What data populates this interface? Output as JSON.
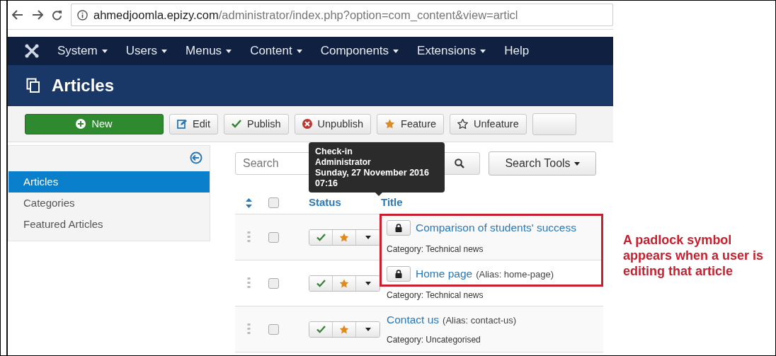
{
  "browser": {
    "host": "ahmedjoomla.epizy.com",
    "path": "/administrator/index.php?option=com_content&view=articl"
  },
  "menu": [
    {
      "label": "System",
      "caret": true
    },
    {
      "label": "Users",
      "caret": true
    },
    {
      "label": "Menus",
      "caret": true
    },
    {
      "label": "Content",
      "caret": true
    },
    {
      "label": "Components",
      "caret": true
    },
    {
      "label": "Extensions",
      "caret": true
    },
    {
      "label": "Help",
      "caret": false
    }
  ],
  "page_title": "Articles",
  "toolbar": [
    {
      "label": "New",
      "kind": "new"
    },
    {
      "label": "Edit",
      "kind": "edit"
    },
    {
      "label": "Publish",
      "kind": "publish"
    },
    {
      "label": "Unpublish",
      "kind": "unpublish"
    },
    {
      "label": "Feature",
      "kind": "feature"
    },
    {
      "label": "Unfeature",
      "kind": "unfeature"
    }
  ],
  "sidebar": [
    {
      "label": "Articles",
      "selected": true
    },
    {
      "label": "Categories",
      "selected": false
    },
    {
      "label": "Featured Articles",
      "selected": false
    }
  ],
  "search": {
    "placeholder": "Search"
  },
  "search_tools": "Search Tools",
  "columns": {
    "status": "Status",
    "title": "Title",
    "select_all_checked": false
  },
  "rows": [
    {
      "title": "Comparison of students' success",
      "alias": "",
      "category": "Category: Technical news",
      "checked_out": true,
      "published": true,
      "featured": true,
      "checked": false
    },
    {
      "title": "Home page",
      "alias": "(Alias: home-page)",
      "category": "Category: Technical news",
      "checked_out": true,
      "published": true,
      "featured": true,
      "checked": false
    },
    {
      "title": "Contact us",
      "alias": "(Alias: contact-us)",
      "category": "Category: Uncategorised",
      "checked_out": false,
      "published": true,
      "featured": true,
      "checked": false
    }
  ],
  "tooltip": {
    "heading": "Check-in",
    "lines": [
      "Administrator",
      "Sunday, 27 November 2016",
      "07:16"
    ]
  },
  "annotation": "A padlock symbol appears when a user is editing that article"
}
